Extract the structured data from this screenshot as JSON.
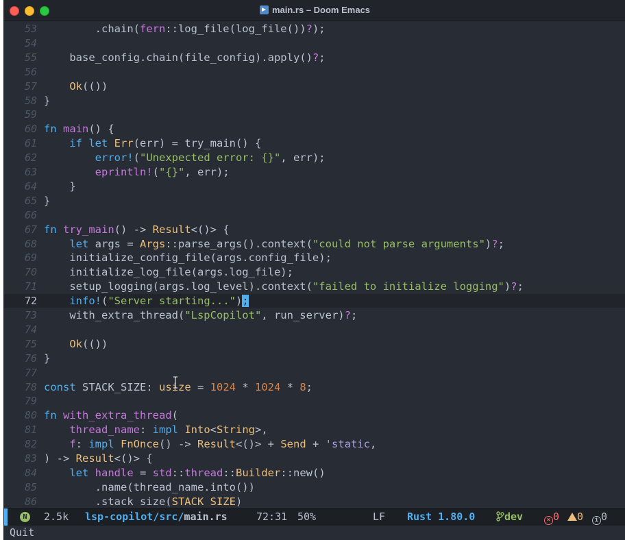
{
  "window": {
    "title": "main.rs – Doom Emacs"
  },
  "editor": {
    "current_line": "72",
    "lines": [
      {
        "n": "53",
        "tokens": [
          [
            "",
            "        .chain("
          ],
          [
            "fn",
            "fern"
          ],
          [
            "",
            "::log_file(log_file())"
          ],
          [
            "ques",
            "?"
          ],
          [
            "",
            ");"
          ]
        ]
      },
      {
        "n": "54",
        "tokens": []
      },
      {
        "n": "55",
        "tokens": [
          [
            "",
            "    base_config.chain(file_config).apply()"
          ],
          [
            "ques",
            "?"
          ],
          [
            "",
            ";"
          ]
        ]
      },
      {
        "n": "56",
        "tokens": []
      },
      {
        "n": "57",
        "tokens": [
          [
            "",
            "    "
          ],
          [
            "ty",
            "Ok"
          ],
          [
            "",
            "(())"
          ]
        ]
      },
      {
        "n": "58",
        "tokens": [
          [
            "",
            "}"
          ]
        ]
      },
      {
        "n": "59",
        "tokens": []
      },
      {
        "n": "60",
        "tokens": [
          [
            "kw",
            "fn"
          ],
          [
            "",
            " "
          ],
          [
            "fn",
            "main"
          ],
          [
            "",
            "() {"
          ]
        ]
      },
      {
        "n": "61",
        "tokens": [
          [
            "",
            "    "
          ],
          [
            "kw",
            "if let"
          ],
          [
            "",
            " "
          ],
          [
            "ty",
            "Err"
          ],
          [
            "",
            "(err) = try_main() {"
          ]
        ]
      },
      {
        "n": "62",
        "tokens": [
          [
            "",
            "        "
          ],
          [
            "kw",
            "error!"
          ],
          [
            "",
            "("
          ],
          [
            "str",
            "\"Unexpected error: {}\""
          ],
          [
            "",
            ", err);"
          ]
        ]
      },
      {
        "n": "63",
        "tokens": [
          [
            "",
            "        "
          ],
          [
            "fn",
            "eprintln!"
          ],
          [
            "",
            "("
          ],
          [
            "str",
            "\"{}\""
          ],
          [
            "",
            ", err);"
          ]
        ]
      },
      {
        "n": "64",
        "tokens": [
          [
            "",
            "    }"
          ]
        ]
      },
      {
        "n": "65",
        "tokens": [
          [
            "",
            "}"
          ]
        ]
      },
      {
        "n": "66",
        "tokens": []
      },
      {
        "n": "67",
        "tokens": [
          [
            "kw",
            "fn"
          ],
          [
            "",
            " "
          ],
          [
            "fn",
            "try_main"
          ],
          [
            "",
            "() -> "
          ],
          [
            "ty",
            "Result"
          ],
          [
            "",
            "<()> {"
          ]
        ]
      },
      {
        "n": "68",
        "tokens": [
          [
            "",
            "    "
          ],
          [
            "kw",
            "let"
          ],
          [
            "",
            " args = "
          ],
          [
            "ty",
            "Args"
          ],
          [
            "",
            "::parse_args().context("
          ],
          [
            "str",
            "\"could not parse arguments\""
          ],
          [
            "",
            ")"
          ],
          [
            "ques",
            "?"
          ],
          [
            "",
            ";"
          ]
        ]
      },
      {
        "n": "69",
        "tokens": [
          [
            "",
            "    initialize_config_file(args.config_file);"
          ]
        ]
      },
      {
        "n": "70",
        "tokens": [
          [
            "",
            "    initialize_log_file(args.log_file);"
          ]
        ]
      },
      {
        "n": "71",
        "tokens": [
          [
            "",
            "    setup_logging(args.log_level).context("
          ],
          [
            "str",
            "\"failed to initialize logging\""
          ],
          [
            "",
            ")"
          ],
          [
            "ques",
            "?"
          ],
          [
            "",
            ";"
          ]
        ]
      },
      {
        "n": "72",
        "tokens": [
          [
            "",
            "    "
          ],
          [
            "kw",
            "info!"
          ],
          [
            "",
            "("
          ],
          [
            "str",
            "\"Server starting...\""
          ],
          [
            "",
            ")"
          ],
          [
            "cursor",
            ";"
          ]
        ]
      },
      {
        "n": "73",
        "tokens": [
          [
            "",
            "    with_extra_thread("
          ],
          [
            "str",
            "\"LspCopilot\""
          ],
          [
            "",
            ", run_server)"
          ],
          [
            "ques",
            "?"
          ],
          [
            "",
            ";"
          ]
        ]
      },
      {
        "n": "74",
        "tokens": []
      },
      {
        "n": "75",
        "tokens": [
          [
            "",
            "    "
          ],
          [
            "ty",
            "Ok"
          ],
          [
            "",
            "(())"
          ]
        ]
      },
      {
        "n": "76",
        "tokens": [
          [
            "",
            "}"
          ]
        ]
      },
      {
        "n": "77",
        "tokens": []
      },
      {
        "n": "78",
        "tokens": [
          [
            "kw",
            "const"
          ],
          [
            "",
            " STACK_SIZE: "
          ],
          [
            "ty",
            "usize"
          ],
          [
            "",
            " = "
          ],
          [
            "num",
            "1024"
          ],
          [
            "",
            " * "
          ],
          [
            "num",
            "1024"
          ],
          [
            "",
            " * "
          ],
          [
            "num",
            "8"
          ],
          [
            "",
            ";"
          ]
        ]
      },
      {
        "n": "79",
        "tokens": []
      },
      {
        "n": "80",
        "tokens": [
          [
            "kw",
            "fn"
          ],
          [
            "",
            " "
          ],
          [
            "fn",
            "with_extra_thread"
          ],
          [
            "",
            "("
          ]
        ]
      },
      {
        "n": "81",
        "tokens": [
          [
            "",
            "    "
          ],
          [
            "fn",
            "thread_name"
          ],
          [
            "",
            ": "
          ],
          [
            "kw",
            "impl"
          ],
          [
            "",
            " "
          ],
          [
            "ty",
            "Into"
          ],
          [
            "",
            "<"
          ],
          [
            "ty",
            "String"
          ],
          [
            "",
            ">,"
          ]
        ]
      },
      {
        "n": "82",
        "tokens": [
          [
            "",
            "    "
          ],
          [
            "fn",
            "f"
          ],
          [
            "",
            ": "
          ],
          [
            "kw",
            "impl"
          ],
          [
            "",
            " "
          ],
          [
            "ty",
            "FnOnce"
          ],
          [
            "",
            "() -> "
          ],
          [
            "ty",
            "Result"
          ],
          [
            "",
            "<()> + "
          ],
          [
            "ty",
            "Send"
          ],
          [
            "",
            " + "
          ],
          [
            "cst",
            "'static"
          ],
          [
            "",
            ","
          ]
        ]
      },
      {
        "n": "83",
        "tokens": [
          [
            "",
            ") -> "
          ],
          [
            "ty",
            "Result"
          ],
          [
            "",
            "<()> {"
          ]
        ]
      },
      {
        "n": "84",
        "tokens": [
          [
            "",
            "    "
          ],
          [
            "kw",
            "let"
          ],
          [
            "",
            " "
          ],
          [
            "fn",
            "handle"
          ],
          [
            "",
            " = "
          ],
          [
            "fn",
            "std"
          ],
          [
            "",
            "::"
          ],
          [
            "fn",
            "thread"
          ],
          [
            "",
            "::"
          ],
          [
            "ty",
            "Builder"
          ],
          [
            "",
            "::new()"
          ]
        ]
      },
      {
        "n": "85",
        "tokens": [
          [
            "",
            "        .name(thread_name.into())"
          ]
        ]
      },
      {
        "n": "86",
        "tokens": [
          [
            "",
            "        .stack_size("
          ],
          [
            "ty",
            "STACK_SIZE"
          ],
          [
            "",
            ")"
          ]
        ]
      }
    ]
  },
  "modeline": {
    "mode_badge": "N",
    "size": "2.5k",
    "path_dir": "lsp-copilot/src/",
    "path_file": "main.rs",
    "position": "72:31",
    "percent": "50%",
    "eol": "LF",
    "language": "Rust 1.80.0",
    "branch": "dev",
    "errors": "0",
    "warnings": "0",
    "infos": "0"
  },
  "minibuffer": {
    "text": "Quit"
  },
  "colors": {
    "background": "#282c34",
    "keyword": "#51afef",
    "function": "#c678dd",
    "string": "#98be65",
    "type": "#ECBE7B",
    "number": "#da8548"
  }
}
